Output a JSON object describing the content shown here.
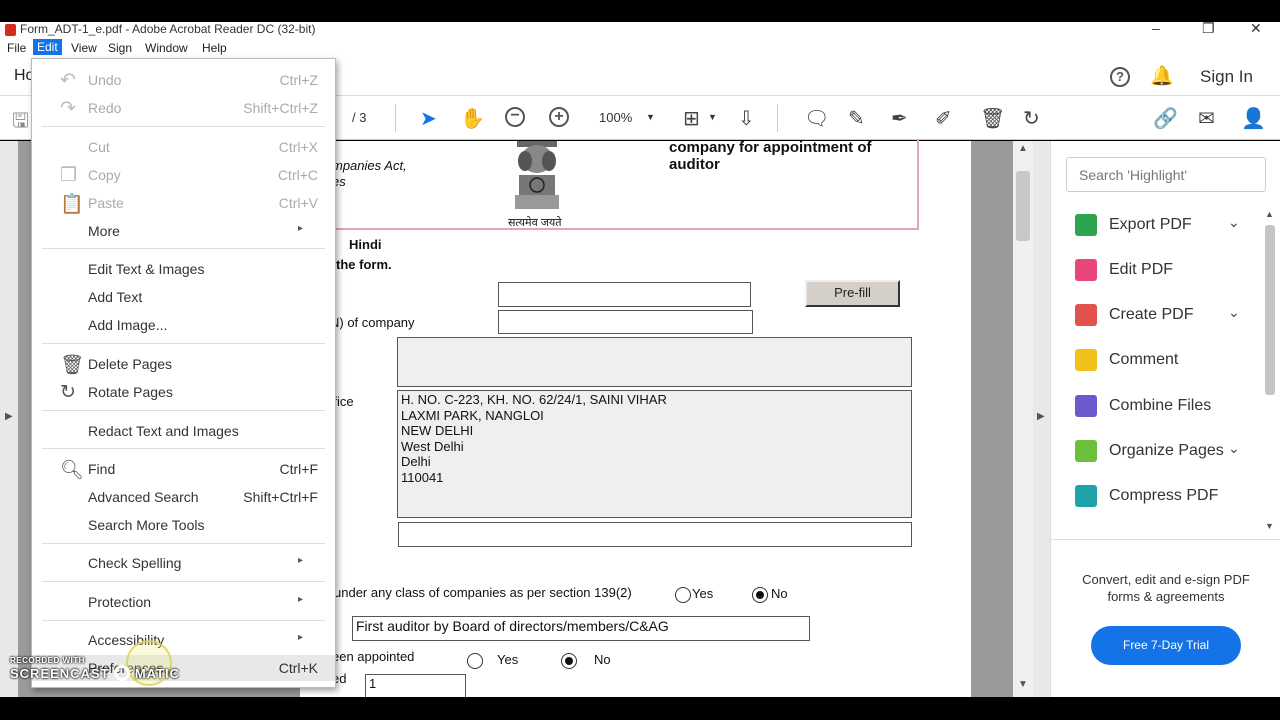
{
  "titlebar": {
    "title": "Form_ADT-1_e.pdf - Adobe Acrobat Reader DC (32-bit)"
  },
  "menubar": [
    "File",
    "Edit",
    "View",
    "Sign",
    "Window",
    "Help"
  ],
  "topbar": {
    "home": "Ho",
    "sign_in": "Sign In"
  },
  "toolbar": {
    "page_total": "/ 3",
    "zoom": "100%"
  },
  "edit_menu": [
    {
      "label": "Undo",
      "shortcut": "Ctrl+Z",
      "icon": "undo-icon",
      "disabled": true
    },
    {
      "label": "Redo",
      "shortcut": "Shift+Ctrl+Z",
      "icon": "redo-icon",
      "disabled": true
    },
    {
      "label": "Cut",
      "shortcut": "Ctrl+X",
      "disabled": true
    },
    {
      "label": "Copy",
      "shortcut": "Ctrl+C",
      "icon": "copy-icon",
      "disabled": true
    },
    {
      "label": "Paste",
      "shortcut": "Ctrl+V",
      "icon": "paste-icon",
      "disabled": true
    },
    {
      "label": "More",
      "submenu": true
    },
    {
      "label": "Edit Text & Images"
    },
    {
      "label": "Add Text"
    },
    {
      "label": "Add Image..."
    },
    {
      "label": "Delete Pages",
      "icon": "trash-icon"
    },
    {
      "label": "Rotate Pages",
      "icon": "rotate-icon"
    },
    {
      "label": "Redact Text and Images"
    },
    {
      "label": "Find",
      "shortcut": "Ctrl+F",
      "icon": "search-icon"
    },
    {
      "label": "Advanced Search",
      "shortcut": "Shift+Ctrl+F"
    },
    {
      "label": "Search More Tools"
    },
    {
      "label": "Check Spelling",
      "submenu": true
    },
    {
      "label": "Protection",
      "submenu": true
    },
    {
      "label": "Accessibility",
      "submenu": true
    },
    {
      "label": "Preferences...",
      "shortcut": "Ctrl+K"
    }
  ],
  "document": {
    "header_right": "company for appointment of",
    "header_right2": "auditor",
    "act_line1": "mpanies Act,",
    "act_line2": "es",
    "emblem_caption": "सत्यमेव जयते",
    "lang_hindi": "Hindi",
    "lang_line2": "the form.",
    "prefill": "Pre-fill",
    "cin_label": "N) of company",
    "office_label": "ffice",
    "address": [
      "H. NO. C-223, KH. NO. 62/24/1, SAINI VIHAR",
      "LAXMI PARK, NANGLOI",
      "NEW DELHI",
      "West Delhi",
      "Delhi",
      "110041"
    ],
    "class_question": "under any class of companies as per section 139(2)",
    "yes": "Yes",
    "no": "No",
    "first_auditor": "First auditor by Board of directors/members/C&AG",
    "appointed_label": "een appointed",
    "last_label": "ed",
    "count_value": "1"
  },
  "right_panel": {
    "search_placeholder": "Search 'Highlight'",
    "tools": [
      {
        "label": "Export PDF",
        "icon": "export-pdf-icon",
        "color": "#2da44e",
        "expand": true
      },
      {
        "label": "Edit PDF",
        "icon": "edit-pdf-icon",
        "color": "#e8477a",
        "expand": false
      },
      {
        "label": "Create PDF",
        "icon": "create-pdf-icon",
        "color": "#e0524b",
        "expand": true
      },
      {
        "label": "Comment",
        "icon": "comment-icon",
        "color": "#f2c01a",
        "expand": false
      },
      {
        "label": "Combine Files",
        "icon": "combine-files-icon",
        "color": "#6a5acd",
        "expand": false
      },
      {
        "label": "Organize Pages",
        "icon": "organize-pages-icon",
        "color": "#6cbf3a",
        "expand": true
      },
      {
        "label": "Compress PDF",
        "icon": "compress-pdf-icon",
        "color": "#1ea3a8",
        "expand": false
      }
    ],
    "promo_line1": "Convert, edit and e-sign PDF",
    "promo_line2": "forms & agreements",
    "trial_button": "Free 7-Day Trial"
  },
  "watermark": {
    "line1": "RECORDED WITH",
    "line2": "SCREENCAST",
    "line3": "MATIC"
  }
}
